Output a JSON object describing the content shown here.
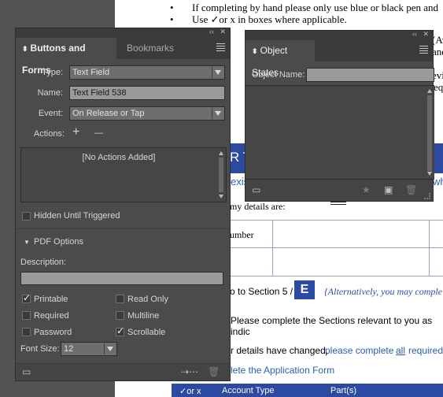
{
  "document": {
    "bullet1": "If completing by hand please only use blue or black pen and",
    "bullet2": "Use ✓or x in boxes where applicable.",
    "frag_exis": "exis",
    "frag_my_details": "my details are:",
    "frag_number": "umber",
    "frag_section": "o to Section 5 /",
    "section_letter": "E",
    "frag_alternatively": "{Alternatively, you may comple",
    "frag_please_complete": "Please complete the Sections relevant to you as indic",
    "frag_details_changed": "r details have changed,",
    "frag_details_link": "please complete",
    "frag_all": "all",
    "frag_required": "required",
    "frag_application": "lete the Application Form",
    "band_text": "R T",
    "right_frag_1": "(Av",
    "right_frag_2": "and",
    "right_frag_3": "evi",
    "right_frag_4": "eq",
    "right_frag_5": "wh",
    "bottom_col1": "✓or x",
    "bottom_col2": "Account Type",
    "bottom_col3": "Part(s)"
  },
  "buttons_forms": {
    "tab_active": "Buttons and Forms",
    "tab_inactive": "Bookmarks",
    "type_label": "Type:",
    "type_value": "Text Field",
    "name_label": "Name:",
    "name_value": "Text Field 538",
    "event_label": "Event:",
    "event_value": "On Release or Tap",
    "actions_label": "Actions:",
    "add_symbol": "+",
    "remove_symbol": "—",
    "no_actions": "[No Actions Added]",
    "hidden_until_triggered": "Hidden Until Triggered",
    "pdf_options": "PDF Options",
    "description_label": "Description:",
    "description_value": "",
    "printable": "Printable",
    "read_only": "Read Only",
    "required": "Required",
    "multiline": "Multiline",
    "password": "Password",
    "scrollable": "Scrollable",
    "font_size_label": "Font Size:",
    "font_size_value": "12"
  },
  "object_states": {
    "title": "Object States",
    "object_name_label": "Object Name:",
    "object_name_value": ""
  },
  "colors": {
    "panel_bg": "#4b4b4b",
    "doc_blue": "#2c4aa1",
    "link_blue": "#2a5db0"
  }
}
